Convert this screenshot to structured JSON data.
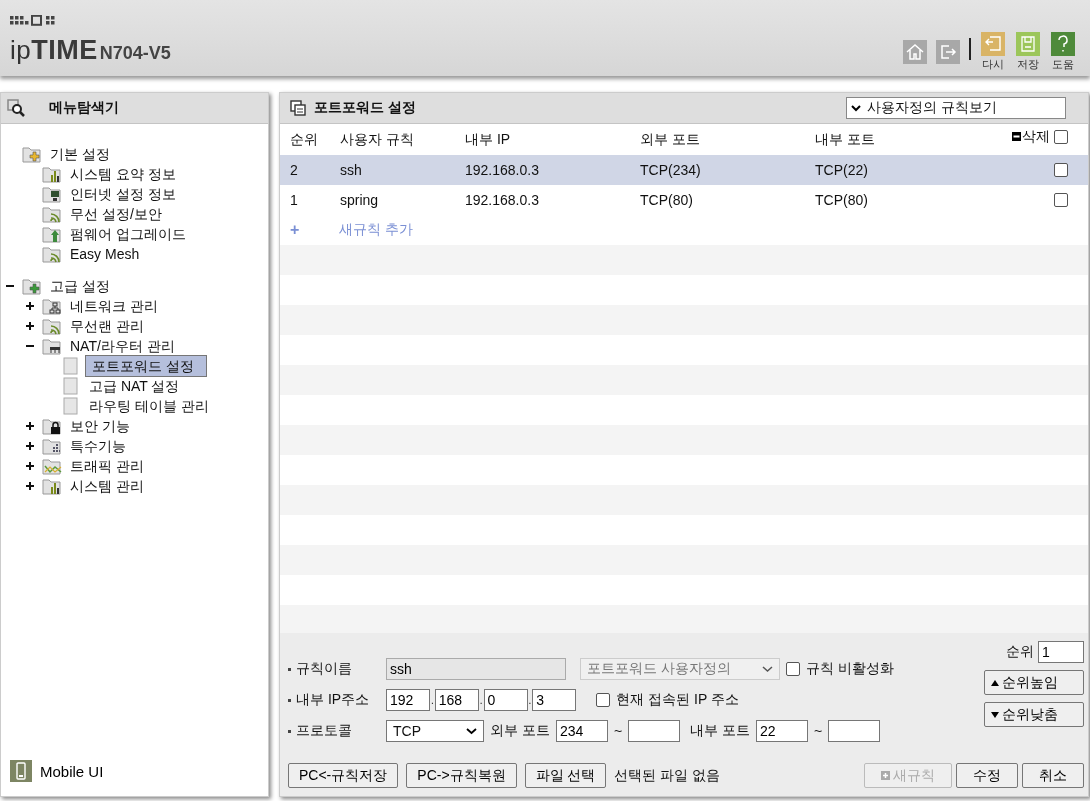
{
  "header": {
    "brand": "ip**TIME**",
    "model": "N704-V5",
    "actions": [
      {
        "label": "다시",
        "color": "#d9b466",
        "kind": "undo"
      },
      {
        "label": "저장",
        "color": "#9cc65a",
        "kind": "save"
      },
      {
        "label": "도움",
        "color": "#4e8a3a",
        "kind": "help"
      }
    ]
  },
  "menu": {
    "title": "메뉴탐색기",
    "tree": [
      {
        "label": "기본 설정",
        "kind": "folder-yellow",
        "children": [
          {
            "label": "시스템 요약 정보",
            "kind": "chart"
          },
          {
            "label": "인터넷 설정 정보",
            "kind": "monitor"
          },
          {
            "label": "무선 설정/보안",
            "kind": "wifi"
          },
          {
            "label": "펌웨어 업그레이드",
            "kind": "upgrade"
          },
          {
            "label": "Easy Mesh",
            "kind": "wifi"
          }
        ]
      },
      {
        "label": "고급 설정",
        "kind": "folder-green",
        "expanded": true,
        "children": [
          {
            "label": "네트워크 관리",
            "kind": "network",
            "expanded": false
          },
          {
            "label": "무선랜 관리",
            "kind": "wifi",
            "expanded": false
          },
          {
            "label": "NAT/라우터 관리",
            "kind": "router",
            "expanded": true,
            "children": [
              {
                "label": "포트포워드 설정",
                "kind": "page",
                "selected": true
              },
              {
                "label": "고급 NAT 설정",
                "kind": "page",
                "selected": false
              },
              {
                "label": "라우팅 테이블 관리",
                "kind": "page",
                "selected": false
              }
            ]
          },
          {
            "label": "보안 기능",
            "kind": "lock",
            "expanded": false
          },
          {
            "label": "특수기능",
            "kind": "dots",
            "expanded": false
          },
          {
            "label": "트래픽 관리",
            "kind": "traffic",
            "expanded": false
          },
          {
            "label": "시스템 관리",
            "kind": "chart",
            "expanded": false
          }
        ]
      }
    ],
    "footer": "Mobile UI"
  },
  "panel": {
    "title": "포트포워드 설정",
    "view_select": "사용자정의 규칙보기",
    "columns": [
      "순위",
      "사용자 규칙",
      "내부 IP",
      "외부 포트",
      "내부 포트",
      "삭제"
    ],
    "select_all_checked": false,
    "rows": [
      {
        "cells": [
          "2",
          "ssh",
          "192.168.0.3",
          "TCP(234)",
          "TCP(22)"
        ],
        "selected": true,
        "checked": false
      },
      {
        "cells": [
          "1",
          "spring",
          "192.168.0.3",
          "TCP(80)",
          "TCP(80)"
        ],
        "selected": false,
        "checked": false
      }
    ],
    "add_rule": {
      "icon": "+",
      "label": "새규칙 추가"
    }
  },
  "form": {
    "name": {
      "label": "규칙이름",
      "value": "ssh",
      "disabled": true
    },
    "preset": {
      "value": "포트포워드 사용자정의",
      "disabled": true
    },
    "disable_rule": {
      "label": "규칙 비활성화",
      "checked": false
    },
    "ip": {
      "label": "내부 IP주소",
      "parts": [
        "192",
        "168",
        "0",
        "3"
      ],
      "sep": "."
    },
    "current_ip": {
      "label": "현재 접속된 IP 주소",
      "checked": false
    },
    "protocol": {
      "label": "프로토콜",
      "value": "TCP"
    },
    "ext_port": {
      "label": "외부 포트",
      "from": "234",
      "sep": "~"
    },
    "int_port": {
      "label": "내부 포트",
      "from": "22",
      "sep": "~"
    },
    "order": {
      "label": "순위",
      "value": "1"
    },
    "move_buttons": [
      {
        "label": "순위높임",
        "kind": "up"
      },
      {
        "label": "순위낮춤",
        "kind": "down"
      }
    ],
    "file_buttons": [
      "PC<-규칙저장",
      "PC->규칙복원",
      "파일 선택"
    ],
    "file_status": "선택된 파일 없음",
    "actions": [
      {
        "label": "새규칙",
        "kind": "new",
        "disabled": true
      },
      {
        "label": "수정",
        "kind": "plain",
        "disabled": false
      },
      {
        "label": "취소",
        "kind": "plain",
        "disabled": false
      }
    ]
  }
}
